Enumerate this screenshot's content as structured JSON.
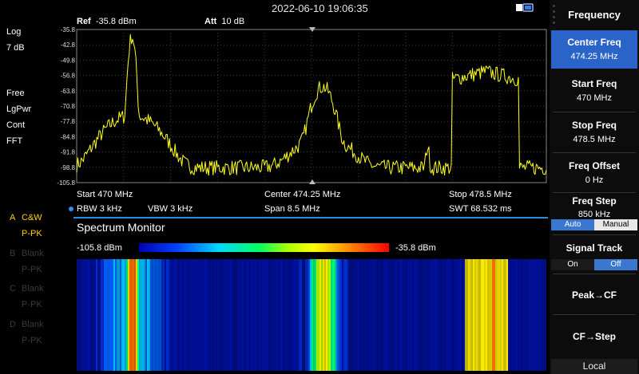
{
  "header": {
    "timestamp": "2022-06-10 19:06:35",
    "battery_icon": "battery-usb-icon"
  },
  "left_panel": {
    "scale_type": "Log",
    "scale_div": "7 dB",
    "labels": [
      "Free",
      "LgPwr",
      "Cont",
      "FFT"
    ],
    "traces": [
      {
        "letter": "A",
        "name": "C&W",
        "mode": "P-PK",
        "active": true
      },
      {
        "letter": "B",
        "name": "Blank",
        "mode": "P-PK",
        "active": false
      },
      {
        "letter": "C",
        "name": "Blank",
        "mode": "P-PK",
        "active": false
      },
      {
        "letter": "D",
        "name": "Blank",
        "mode": "P-PK",
        "active": false
      }
    ]
  },
  "spectrum": {
    "ref_label": "Ref",
    "ref_value": "-35.8 dBm",
    "att_label": "Att",
    "att_value": "10 dB",
    "y_ticks": [
      "-35.8",
      "-42.8",
      "-49.8",
      "-56.8",
      "-63.8",
      "-70.8",
      "-77.8",
      "-84.8",
      "-91.8",
      "-98.8",
      "-105.8"
    ],
    "start": "Start  470 MHz",
    "center": "Center  474.25 MHz",
    "stop": "Stop  478.5 MHz",
    "rbw": "RBW  3 kHz",
    "vbw": "VBW  3 kHz",
    "span": "Span    8.5 MHz",
    "swt": "SWT  68.532 ms"
  },
  "chart_data": {
    "type": "line",
    "x_start_mhz": 470,
    "x_stop_mhz": 478.5,
    "ylim": [
      -105.8,
      -35.8
    ],
    "trace_color": "#ffff20",
    "features": [
      {
        "x_mhz": 471.0,
        "peak_dbm": -39,
        "width_mhz": 0.06
      },
      {
        "x_mhz": 471.0,
        "peak_dbm": -75,
        "width_mhz": 0.55
      },
      {
        "x_mhz": 474.45,
        "peak_dbm": -62,
        "width_mhz": 0.2
      },
      {
        "x_mhz": 474.45,
        "peak_dbm": -85,
        "width_mhz": 0.6
      },
      {
        "x_mhz": 476.35,
        "peak_dbm": -90,
        "width_mhz": 0.04
      },
      {
        "band_start_mhz": 476.8,
        "band_stop_mhz": 478.0,
        "level_dbm": -55
      }
    ],
    "noise_floor_dbm": -99
  },
  "monitor": {
    "title": "Spectrum Monitor",
    "scale_min": "-105.8 dBm",
    "scale_max": "-35.8 dBm"
  },
  "right_panel": {
    "title": "Frequency",
    "center_freq_label": "Center Freq",
    "center_freq_value": "474.25 MHz",
    "start_freq_label": "Start Freq",
    "start_freq_value": "470 MHz",
    "stop_freq_label": "Stop Freq",
    "stop_freq_value": "478.5 MHz",
    "offset_label": "Freq Offset",
    "offset_value": "0 Hz",
    "step_label": "Freq Step",
    "step_value": "850 kHz",
    "step_auto": "Auto",
    "step_manual": "Manual",
    "signal_track_label": "Signal Track",
    "signal_track_on": "On",
    "signal_track_off": "Off",
    "peak_cf": "Peak→CF",
    "cf_step": "CF→Step",
    "local": "Local"
  }
}
